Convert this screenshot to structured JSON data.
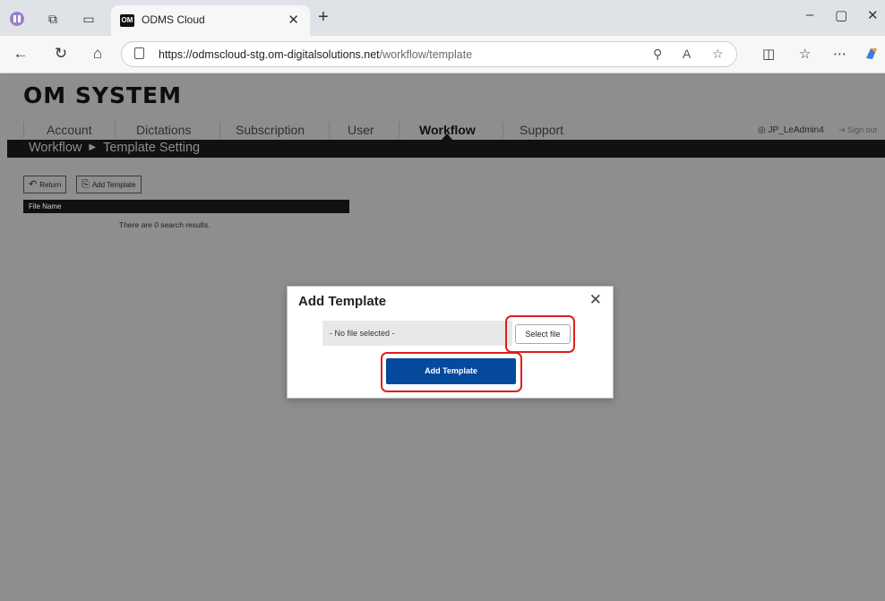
{
  "browser": {
    "tab_title": "ODMS Cloud",
    "tab_favicon_text": "OM",
    "url_host": "https://odmscloud-stg.om-digitalsolutions.net",
    "url_path": "/workflow/template"
  },
  "site": {
    "logo": "OM SYSTEM",
    "nav": [
      "Account",
      "Dictations",
      "Subscription",
      "User",
      "Workflow",
      "Support"
    ],
    "active_nav": "Workflow",
    "user_name": "JP_LeAdmin4",
    "sign_out": "Sign out"
  },
  "breadcrumb": {
    "root": "Workflow",
    "current": "Template Setting"
  },
  "toolbar": {
    "return_label": "Return",
    "add_template_label": "Add Template"
  },
  "table": {
    "column_header": "File Name",
    "empty_message": "There are 0 search results."
  },
  "modal": {
    "title": "Add Template",
    "file_placeholder": "- No file selected -",
    "select_file_label": "Select file",
    "submit_label": "Add Template"
  },
  "colors": {
    "primary_button": "#054a9c",
    "highlight": "#e01e1e"
  }
}
